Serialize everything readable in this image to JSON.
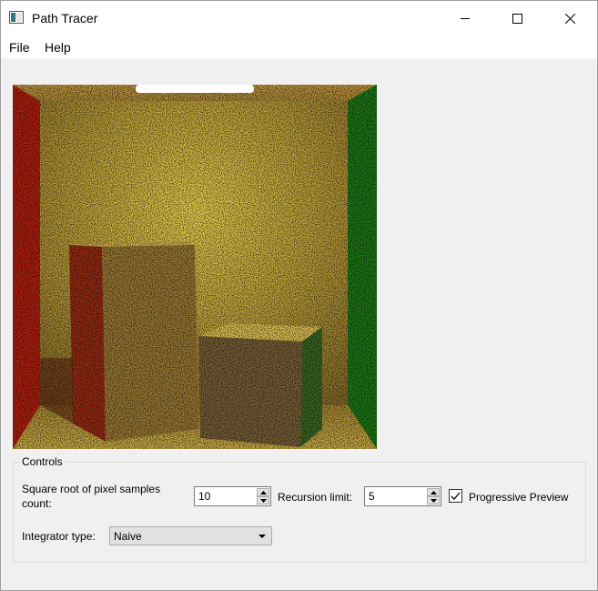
{
  "window": {
    "title": "Path Tracer"
  },
  "menu": {
    "items": [
      "File",
      "Help"
    ]
  },
  "render": {
    "description_icon": "cornell-box-render"
  },
  "controls": {
    "group_title": "Controls",
    "samples_label_line1": "Square root of pixel samples",
    "samples_label_line2": "count:",
    "samples_value": "10",
    "recursion_label": "Recursion limit:",
    "recursion_value": "5",
    "progressive_label": "Progressive Preview",
    "progressive_checked": true,
    "integrator_label": "Integrator type:",
    "integrator_value": "Naive"
  },
  "colors": {
    "window_bg": "#f0f0f0",
    "left_wall": "#c81e10",
    "right_wall": "#2a8a1c",
    "back_wall": "#c8a844",
    "light": "#ffffff"
  }
}
